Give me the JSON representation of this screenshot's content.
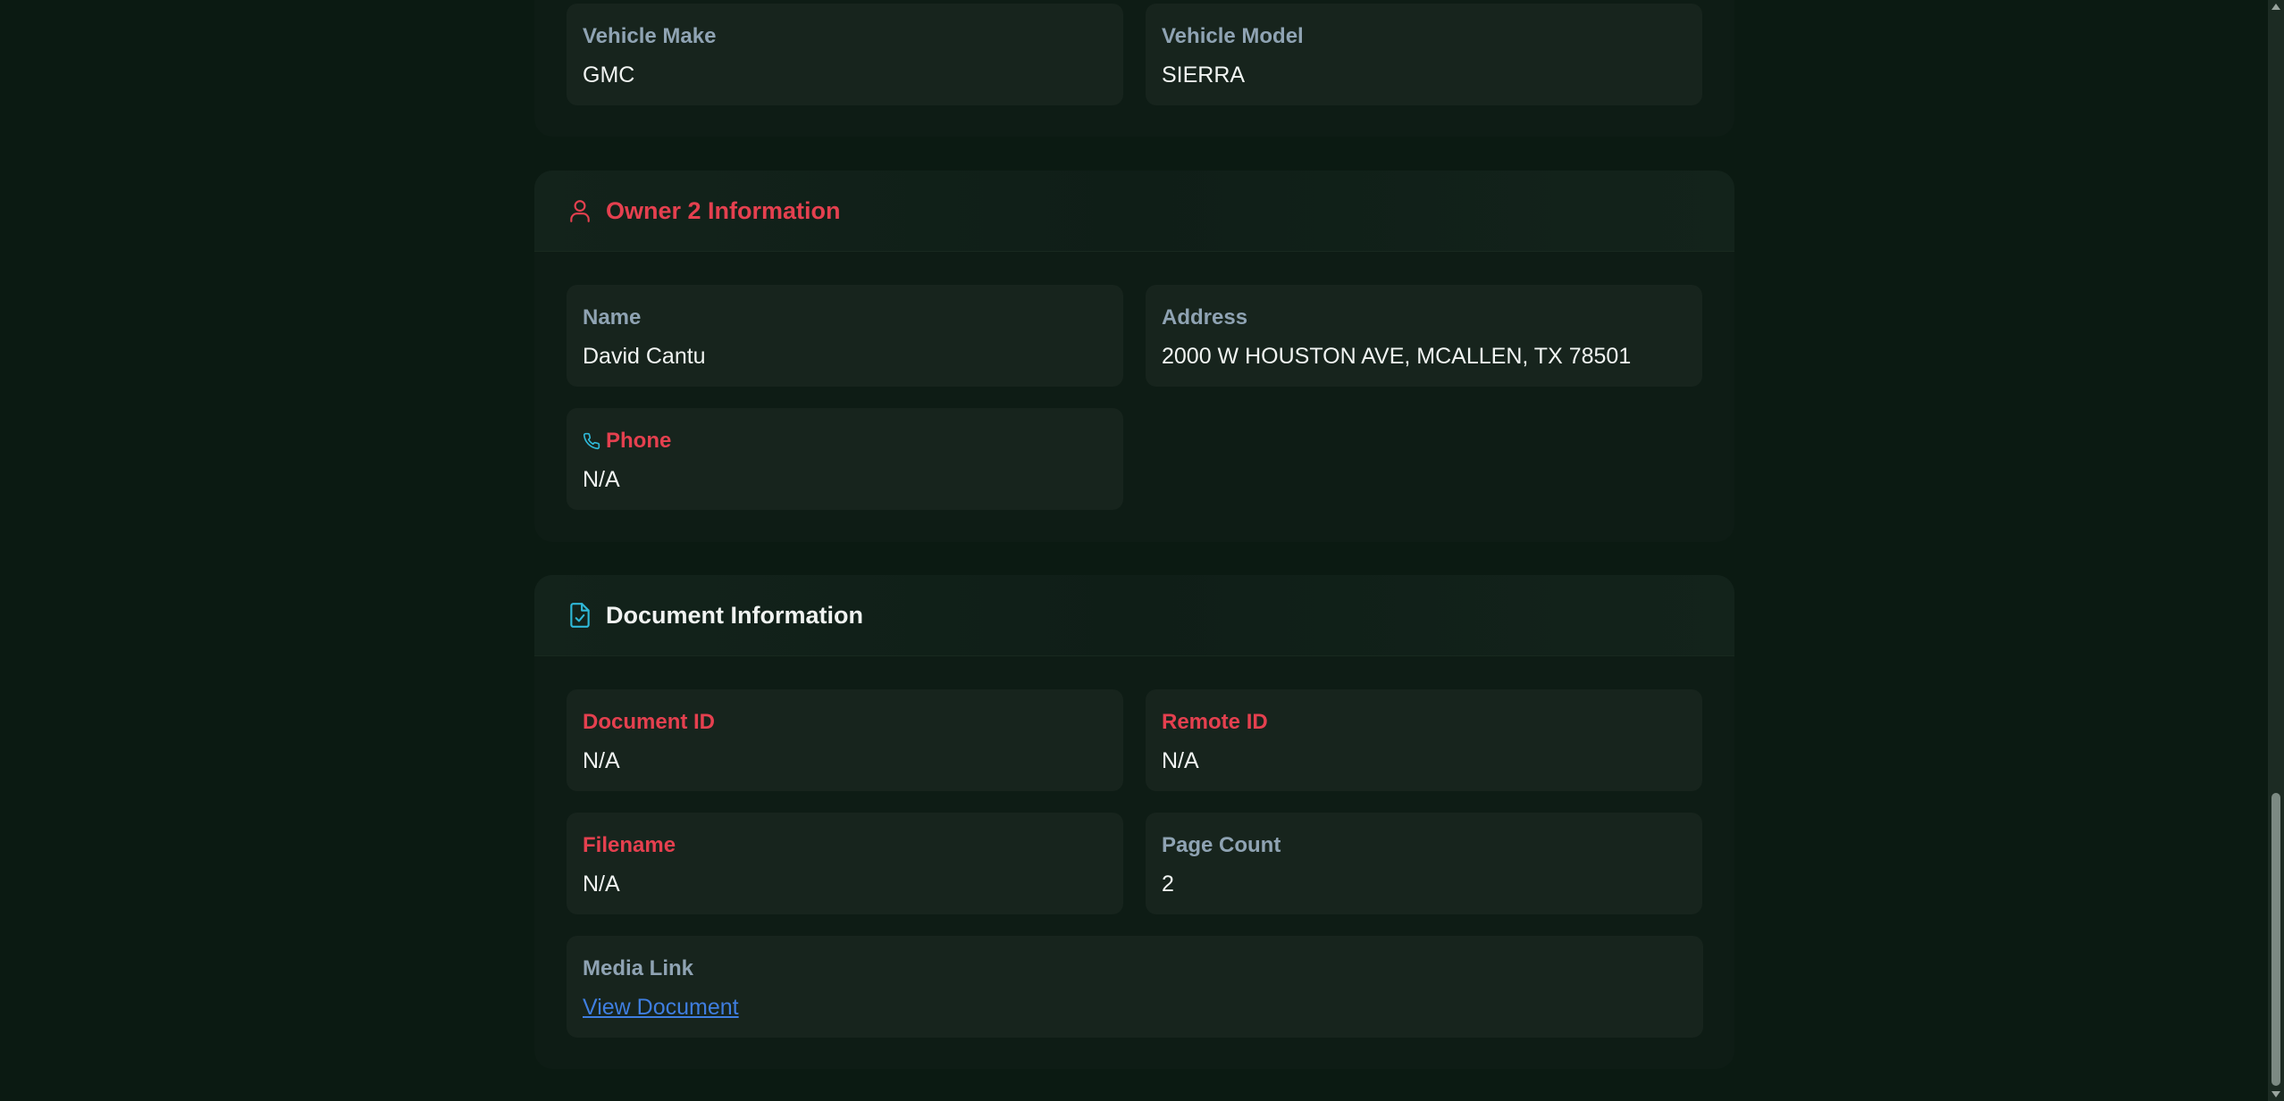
{
  "vehicle_section": {
    "make_label": "Vehicle Make",
    "make_value": "GMC",
    "model_label": "Vehicle Model",
    "model_value": "SIERRA"
  },
  "owner2_section": {
    "title": "Owner 2 Information",
    "icon": "user-icon",
    "name_label": "Name",
    "name_value": "David Cantu",
    "address_label": "Address",
    "address_value": "2000 W HOUSTON AVE, MCALLEN, TX 78501",
    "phone_label": "Phone",
    "phone_icon": "phone-icon",
    "phone_value": "N/A"
  },
  "document_section": {
    "title": "Document Information",
    "icon": "file-check-icon",
    "document_id_label": "Document ID",
    "document_id_value": "N/A",
    "remote_id_label": "Remote ID",
    "remote_id_value": "N/A",
    "filename_label": "Filename",
    "filename_value": "N/A",
    "page_count_label": "Page Count",
    "page_count_value": "2",
    "media_link_label": "Media Link",
    "media_link_text": "View Document"
  },
  "colors": {
    "background": "#0b1a12",
    "card": "#0e1c15",
    "field": "#17241d",
    "accent_red": "#e5404f",
    "label_gray": "#8fa3b3",
    "link_blue": "#3f7ee0",
    "icon_cyan": "#2fb8d8"
  }
}
